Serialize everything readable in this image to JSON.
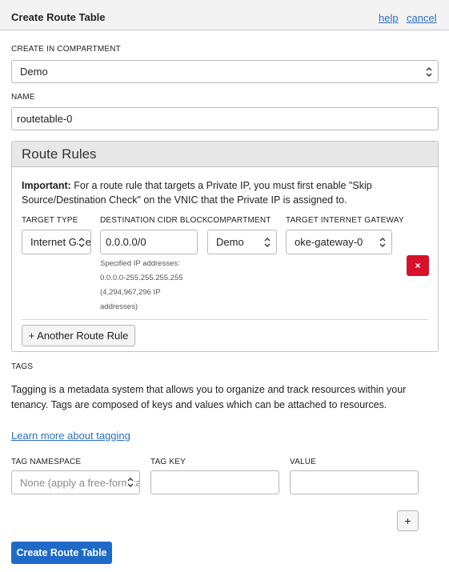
{
  "header": {
    "title": "Create Route Table",
    "help": "help",
    "cancel": "cancel"
  },
  "compartment": {
    "label": "CREATE IN COMPARTMENT",
    "value": "Demo"
  },
  "name": {
    "label": "NAME",
    "value": "routetable-0"
  },
  "route_rules": {
    "title": "Route Rules",
    "important_bold": "Important:",
    "important_line1": " For a route rule that targets a Private IP, you must first enable \"Skip",
    "important_line2": "Source/Destination Check\" on the VNIC that the Private IP is assigned to.",
    "columns": {
      "target_type": "TARGET TYPE",
      "destination": "DESTINATION CIDR BLOCK",
      "compartment": "COMPARTMENT",
      "gateway": "TARGET INTERNET GATEWAY"
    },
    "rule": {
      "target_type": "Internet Gateway",
      "destination": "0.0.0.0/0",
      "compartment": "Demo",
      "gateway": "oke-gateway-0",
      "hint_lines": [
        "Specified IP addresses:",
        "0.0.0.0-255.255.255.255",
        "(4,294,967,296 IP",
        "addresses)"
      ],
      "delete": "×"
    },
    "add_button": "+ Another Route Rule"
  },
  "tags": {
    "label": "TAGS",
    "line1": "Tagging is a metadata system that allows you to organize and track resources within your",
    "line2": "tenancy. Tags are composed of keys and values which can be attached to resources.",
    "learn_more": "Learn more about tagging",
    "namespace_label": "TAG NAMESPACE",
    "namespace_placeholder": "None (apply a free-form tag)",
    "key_label": "TAG KEY",
    "key_value": "",
    "value_label": "VALUE",
    "value_value": "",
    "add": "+"
  },
  "submit": "Create Route Table",
  "icons": {
    "select_chevron": "updown-chevron-icon"
  }
}
